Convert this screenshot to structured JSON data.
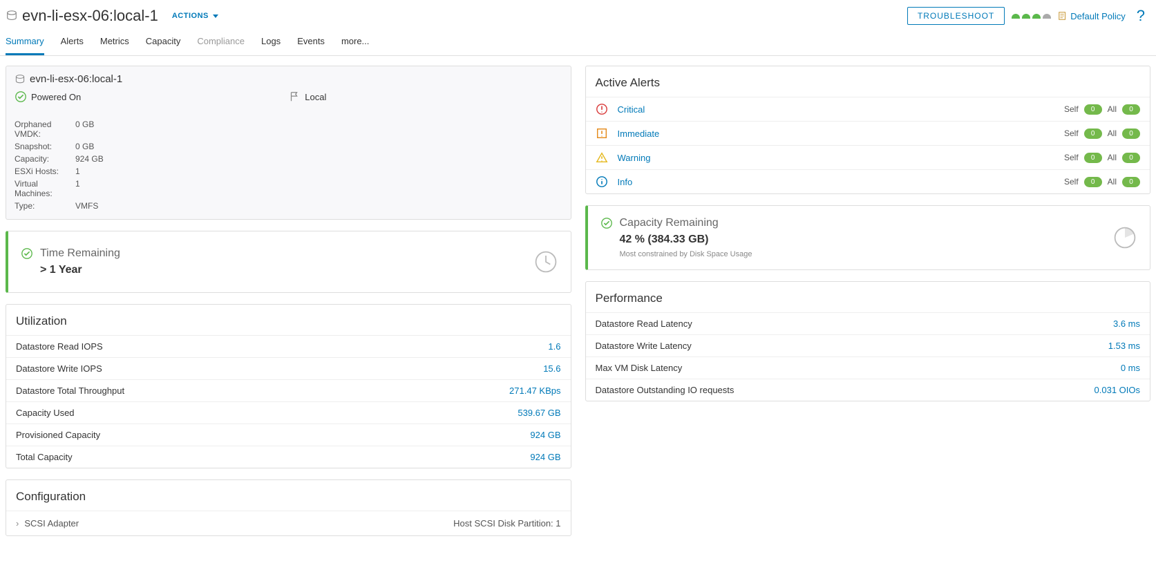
{
  "header": {
    "title": "evn-li-esx-06:local-1",
    "actions": "ACTIONS",
    "troubleshoot": "TROUBLESHOOT",
    "policy": "Default Policy"
  },
  "tabs": [
    "Summary",
    "Alerts",
    "Metrics",
    "Capacity",
    "Compliance",
    "Logs",
    "Events",
    "more..."
  ],
  "info_card": {
    "title": "evn-li-esx-06:local-1",
    "power": "Powered On",
    "local": "Local",
    "rows": [
      {
        "k": "Orphaned VMDK:",
        "v": "0 GB"
      },
      {
        "k": "Snapshot:",
        "v": "0 GB"
      },
      {
        "k": "Capacity:",
        "v": "924 GB"
      },
      {
        "k": "ESXi Hosts:",
        "v": "1"
      },
      {
        "k": "Virtual Machines:",
        "v": "1"
      },
      {
        "k": "Type:",
        "v": "VMFS"
      }
    ]
  },
  "time_card": {
    "title": "Time Remaining",
    "value": "> 1 Year"
  },
  "capacity_card": {
    "title": "Capacity Remaining",
    "value": "42 % (384.33 GB)",
    "sub": "Most constrained by Disk Space Usage"
  },
  "utilization": {
    "title": "Utilization",
    "rows": [
      {
        "k": "Datastore Read IOPS",
        "v": "1.6"
      },
      {
        "k": "Datastore Write IOPS",
        "v": "15.6"
      },
      {
        "k": "Datastore Total Throughput",
        "v": "271.47 KBps"
      },
      {
        "k": "Capacity Used",
        "v": "539.67 GB"
      },
      {
        "k": "Provisioned Capacity",
        "v": "924 GB"
      },
      {
        "k": "Total Capacity",
        "v": "924 GB"
      }
    ]
  },
  "performance": {
    "title": "Performance",
    "rows": [
      {
        "k": "Datastore Read Latency",
        "v": "3.6 ms"
      },
      {
        "k": "Datastore Write Latency",
        "v": "1.53 ms"
      },
      {
        "k": "Max VM Disk Latency",
        "v": "0 ms"
      },
      {
        "k": "Datastore Outstanding IO requests",
        "v": "0.031 OIOs"
      }
    ]
  },
  "configuration": {
    "title": "Configuration",
    "row": {
      "k": "SCSI Adapter",
      "rv": "Host SCSI Disk Partition: 1"
    }
  },
  "alerts": {
    "title": "Active Alerts",
    "self": "Self",
    "all": "All",
    "zero": "0",
    "rows": [
      {
        "label": "Critical",
        "icon": "critical"
      },
      {
        "label": "Immediate",
        "icon": "immediate"
      },
      {
        "label": "Warning",
        "icon": "warning"
      },
      {
        "label": "Info",
        "icon": "info"
      }
    ]
  }
}
